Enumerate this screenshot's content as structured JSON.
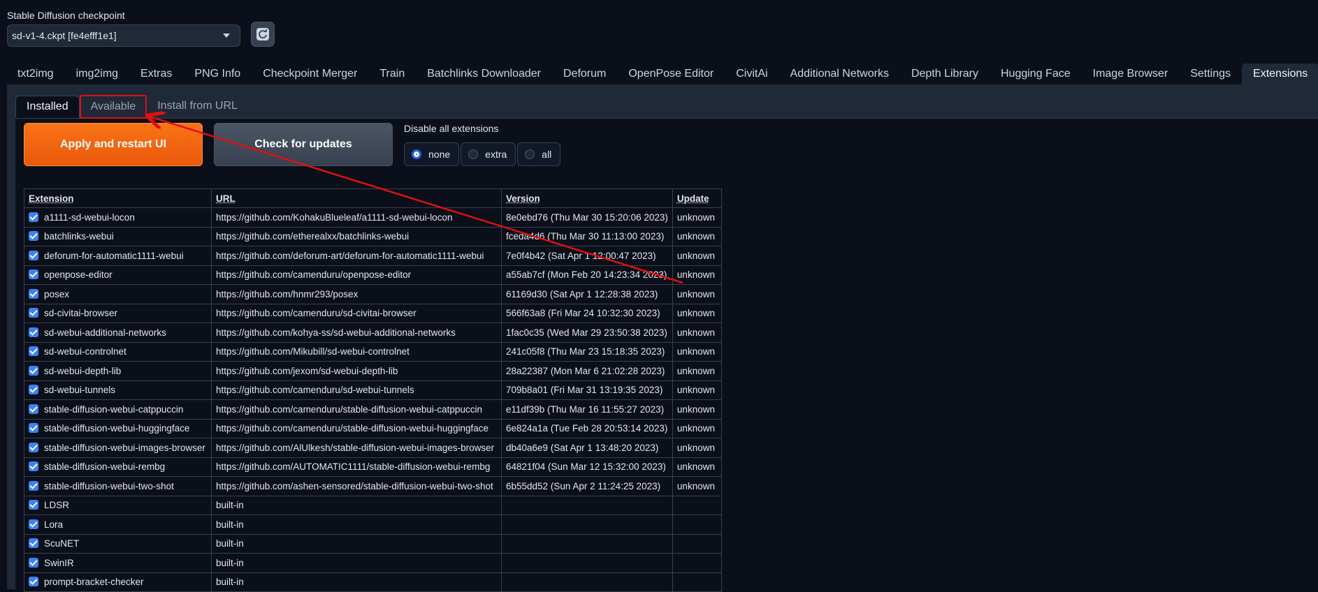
{
  "checkpoint": {
    "label": "Stable Diffusion checkpoint",
    "value": "sd-v1-4.ckpt [fe4efff1e1]"
  },
  "main_tabs": [
    "txt2img",
    "img2img",
    "Extras",
    "PNG Info",
    "Checkpoint Merger",
    "Train",
    "Batchlinks Downloader",
    "Deforum",
    "OpenPose Editor",
    "CivitAi",
    "Additional Networks",
    "Depth Library",
    "Hugging Face",
    "Image Browser",
    "Settings",
    "Extensions"
  ],
  "active_main_tab": "Extensions",
  "sub_tabs": [
    "Installed",
    "Available",
    "Install from URL"
  ],
  "active_sub_tab": "Installed",
  "highlighted_sub_tab": "Available",
  "buttons": {
    "apply": "Apply and restart UI",
    "check": "Check for updates"
  },
  "disable": {
    "label": "Disable all extensions",
    "options": [
      "none",
      "extra",
      "all"
    ],
    "selected": "none"
  },
  "table": {
    "headers": [
      "Extension",
      "URL",
      "Version",
      "Update"
    ],
    "rows": [
      [
        "a1111-sd-webui-locon",
        "https://github.com/KohakuBlueleaf/a1111-sd-webui-locon",
        "8e0ebd76 (Thu Mar 30 15:20:06 2023)",
        "unknown"
      ],
      [
        "batchlinks-webui",
        "https://github.com/etherealxx/batchlinks-webui",
        "fceda4d6 (Thu Mar 30 11:13:00 2023)",
        "unknown"
      ],
      [
        "deforum-for-automatic1111-webui",
        "https://github.com/deforum-art/deforum-for-automatic1111-webui",
        "7e0f4b42 (Sat Apr 1 12:00:47 2023)",
        "unknown"
      ],
      [
        "openpose-editor",
        "https://github.com/camenduru/openpose-editor",
        "a55ab7cf (Mon Feb 20 14:23:34 2023)",
        "unknown"
      ],
      [
        "posex",
        "https://github.com/hnmr293/posex",
        "61169d30 (Sat Apr 1 12:28:38 2023)",
        "unknown"
      ],
      [
        "sd-civitai-browser",
        "https://github.com/camenduru/sd-civitai-browser",
        "566f63a8 (Fri Mar 24 10:32:30 2023)",
        "unknown"
      ],
      [
        "sd-webui-additional-networks",
        "https://github.com/kohya-ss/sd-webui-additional-networks",
        "1fac0c35 (Wed Mar 29 23:50:38 2023)",
        "unknown"
      ],
      [
        "sd-webui-controlnet",
        "https://github.com/Mikubill/sd-webui-controlnet",
        "241c05f8 (Thu Mar 23 15:18:35 2023)",
        "unknown"
      ],
      [
        "sd-webui-depth-lib",
        "https://github.com/jexom/sd-webui-depth-lib",
        "28a22387 (Mon Mar 6 21:02:28 2023)",
        "unknown"
      ],
      [
        "sd-webui-tunnels",
        "https://github.com/camenduru/sd-webui-tunnels",
        "709b8a01 (Fri Mar 31 13:19:35 2023)",
        "unknown"
      ],
      [
        "stable-diffusion-webui-catppuccin",
        "https://github.com/camenduru/stable-diffusion-webui-catppuccin",
        "e11df39b (Thu Mar 16 11:55:27 2023)",
        "unknown"
      ],
      [
        "stable-diffusion-webui-huggingface",
        "https://github.com/camenduru/stable-diffusion-webui-huggingface",
        "6e824a1a (Tue Feb 28 20:53:14 2023)",
        "unknown"
      ],
      [
        "stable-diffusion-webui-images-browser",
        "https://github.com/AlUlkesh/stable-diffusion-webui-images-browser",
        "db40a6e9 (Sat Apr 1 13:48:20 2023)",
        "unknown"
      ],
      [
        "stable-diffusion-webui-rembg",
        "https://github.com/AUTOMATIC1111/stable-diffusion-webui-rembg",
        "64821f04 (Sun Mar 12 15:32:00 2023)",
        "unknown"
      ],
      [
        "stable-diffusion-webui-two-shot",
        "https://github.com/ashen-sensored/stable-diffusion-webui-two-shot",
        "6b55dd52 (Sun Apr 2 11:24:25 2023)",
        "unknown"
      ],
      [
        "LDSR",
        "built-in",
        "",
        ""
      ],
      [
        "Lora",
        "built-in",
        "",
        ""
      ],
      [
        "ScuNET",
        "built-in",
        "",
        ""
      ],
      [
        "SwinIR",
        "built-in",
        "",
        ""
      ],
      [
        "prompt-bracket-checker",
        "built-in",
        "",
        ""
      ]
    ]
  },
  "colors": {
    "accent_orange": "#f97316",
    "annotation_red": "#e01010",
    "checkbox_blue": "#3b82f6"
  }
}
